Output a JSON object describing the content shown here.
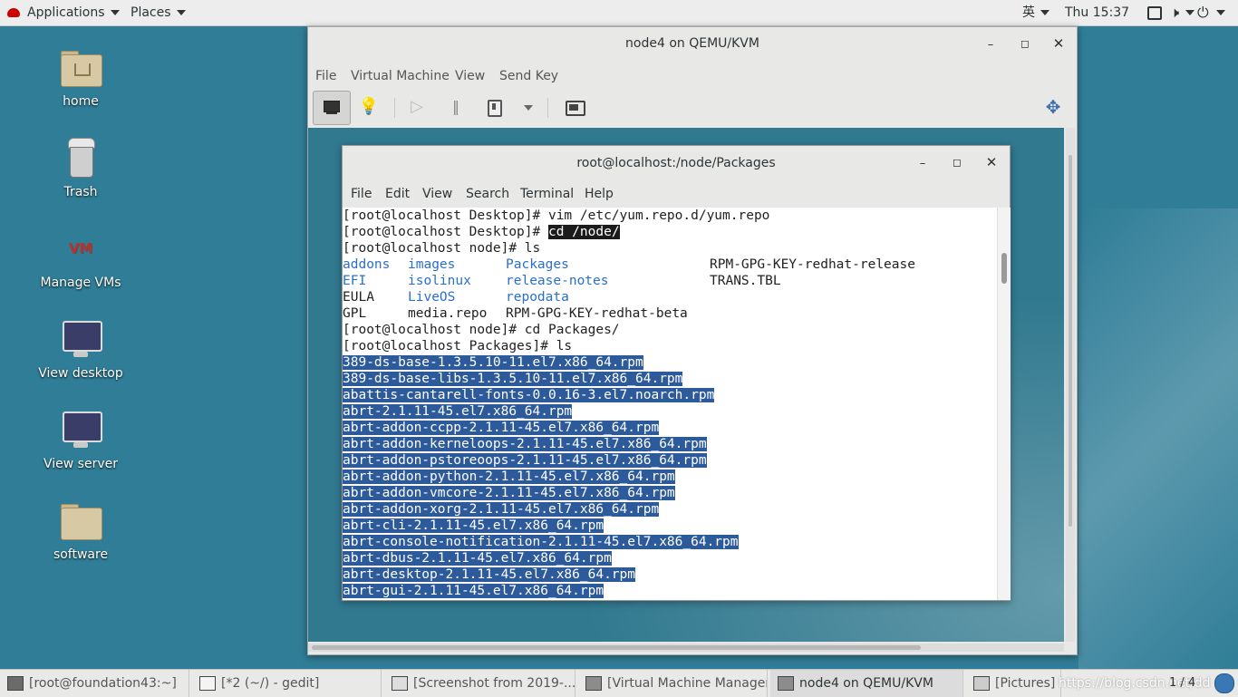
{
  "topbar": {
    "applications": "Applications",
    "places": "Places",
    "ime": "英",
    "clock": "Thu 15:37"
  },
  "desktop_icons": [
    {
      "label": "home"
    },
    {
      "label": "Trash"
    },
    {
      "label": "Manage VMs"
    },
    {
      "label": "View desktop"
    },
    {
      "label": "View server"
    },
    {
      "label": "software"
    }
  ],
  "vm_window": {
    "title": "node4 on QEMU/KVM",
    "menu": [
      "File",
      "Virtual Machine",
      "View",
      "Send Key"
    ]
  },
  "terminal": {
    "title": "root@localhost:/node/Packages",
    "menu": [
      "File",
      "Edit",
      "View",
      "Search",
      "Terminal",
      "Help"
    ],
    "cmd1": "[root@localhost Desktop]# vim /etc/yum.repo.d/yum.repo",
    "cmd2_prompt": "[root@localhost Desktop]# ",
    "cmd2_cmd": "cd /node/",
    "cmd3": "[root@localhost node]# ls",
    "ls_rows": [
      [
        "addons",
        "images",
        "Packages",
        "RPM-GPG-KEY-redhat-release"
      ],
      [
        "EFI",
        "isolinux",
        "release-notes",
        "TRANS.TBL"
      ],
      [
        "EULA",
        "LiveOS",
        "repodata",
        ""
      ],
      [
        "GPL",
        "media.repo",
        "RPM-GPG-KEY-redhat-beta",
        ""
      ]
    ],
    "cmd4": "[root@localhost node]# cd Packages/",
    "cmd5": "[root@localhost Packages]# ls",
    "packages": [
      "389-ds-base-1.3.5.10-11.el7.x86_64.rpm",
      "389-ds-base-libs-1.3.5.10-11.el7.x86_64.rpm",
      "abattis-cantarell-fonts-0.0.16-3.el7.noarch.rpm",
      "abrt-2.1.11-45.el7.x86_64.rpm",
      "abrt-addon-ccpp-2.1.11-45.el7.x86_64.rpm",
      "abrt-addon-kerneloops-2.1.11-45.el7.x86_64.rpm",
      "abrt-addon-pstoreoops-2.1.11-45.el7.x86_64.rpm",
      "abrt-addon-python-2.1.11-45.el7.x86_64.rpm",
      "abrt-addon-vmcore-2.1.11-45.el7.x86_64.rpm",
      "abrt-addon-xorg-2.1.11-45.el7.x86_64.rpm",
      "abrt-cli-2.1.11-45.el7.x86_64.rpm",
      "abrt-console-notification-2.1.11-45.el7.x86_64.rpm",
      "abrt-dbus-2.1.11-45.el7.x86_64.rpm",
      "abrt-desktop-2.1.11-45.el7.x86_64.rpm",
      "abrt-gui-2.1.11-45.el7.x86_64.rpm"
    ]
  },
  "taskbar": {
    "items": [
      "[root@foundation43:~]",
      "[*2 (~/) - gedit]",
      "[Screenshot from 2019-...",
      "[Virtual Machine Manager]",
      "node4 on QEMU/KVM",
      "[Pictures]"
    ],
    "watermark": "https://blog.csdn.net/dd",
    "workspace": "1 / 4"
  },
  "colors": {
    "selection": "#2c5a9a",
    "ls_directory": "#2a6fc9",
    "desktop": "#2f7d97"
  }
}
